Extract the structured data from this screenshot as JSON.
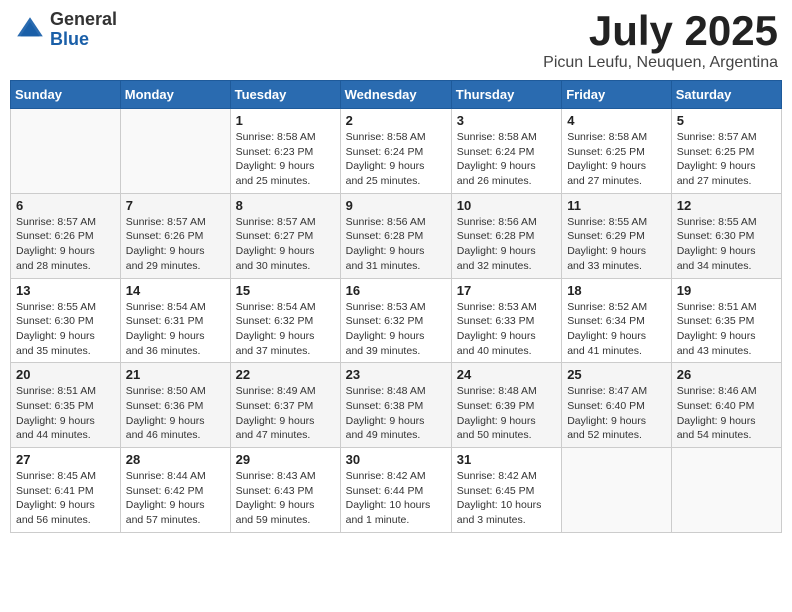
{
  "header": {
    "logo_general": "General",
    "logo_blue": "Blue",
    "month_title": "July 2025",
    "subtitle": "Picun Leufu, Neuquen, Argentina"
  },
  "weekdays": [
    "Sunday",
    "Monday",
    "Tuesday",
    "Wednesday",
    "Thursday",
    "Friday",
    "Saturday"
  ],
  "weeks": [
    [
      {
        "day": "",
        "content": ""
      },
      {
        "day": "",
        "content": ""
      },
      {
        "day": "1",
        "content": "Sunrise: 8:58 AM\nSunset: 6:23 PM\nDaylight: 9 hours\nand 25 minutes."
      },
      {
        "day": "2",
        "content": "Sunrise: 8:58 AM\nSunset: 6:24 PM\nDaylight: 9 hours\nand 25 minutes."
      },
      {
        "day": "3",
        "content": "Sunrise: 8:58 AM\nSunset: 6:24 PM\nDaylight: 9 hours\nand 26 minutes."
      },
      {
        "day": "4",
        "content": "Sunrise: 8:58 AM\nSunset: 6:25 PM\nDaylight: 9 hours\nand 27 minutes."
      },
      {
        "day": "5",
        "content": "Sunrise: 8:57 AM\nSunset: 6:25 PM\nDaylight: 9 hours\nand 27 minutes."
      }
    ],
    [
      {
        "day": "6",
        "content": "Sunrise: 8:57 AM\nSunset: 6:26 PM\nDaylight: 9 hours\nand 28 minutes."
      },
      {
        "day": "7",
        "content": "Sunrise: 8:57 AM\nSunset: 6:26 PM\nDaylight: 9 hours\nand 29 minutes."
      },
      {
        "day": "8",
        "content": "Sunrise: 8:57 AM\nSunset: 6:27 PM\nDaylight: 9 hours\nand 30 minutes."
      },
      {
        "day": "9",
        "content": "Sunrise: 8:56 AM\nSunset: 6:28 PM\nDaylight: 9 hours\nand 31 minutes."
      },
      {
        "day": "10",
        "content": "Sunrise: 8:56 AM\nSunset: 6:28 PM\nDaylight: 9 hours\nand 32 minutes."
      },
      {
        "day": "11",
        "content": "Sunrise: 8:55 AM\nSunset: 6:29 PM\nDaylight: 9 hours\nand 33 minutes."
      },
      {
        "day": "12",
        "content": "Sunrise: 8:55 AM\nSunset: 6:30 PM\nDaylight: 9 hours\nand 34 minutes."
      }
    ],
    [
      {
        "day": "13",
        "content": "Sunrise: 8:55 AM\nSunset: 6:30 PM\nDaylight: 9 hours\nand 35 minutes."
      },
      {
        "day": "14",
        "content": "Sunrise: 8:54 AM\nSunset: 6:31 PM\nDaylight: 9 hours\nand 36 minutes."
      },
      {
        "day": "15",
        "content": "Sunrise: 8:54 AM\nSunset: 6:32 PM\nDaylight: 9 hours\nand 37 minutes."
      },
      {
        "day": "16",
        "content": "Sunrise: 8:53 AM\nSunset: 6:32 PM\nDaylight: 9 hours\nand 39 minutes."
      },
      {
        "day": "17",
        "content": "Sunrise: 8:53 AM\nSunset: 6:33 PM\nDaylight: 9 hours\nand 40 minutes."
      },
      {
        "day": "18",
        "content": "Sunrise: 8:52 AM\nSunset: 6:34 PM\nDaylight: 9 hours\nand 41 minutes."
      },
      {
        "day": "19",
        "content": "Sunrise: 8:51 AM\nSunset: 6:35 PM\nDaylight: 9 hours\nand 43 minutes."
      }
    ],
    [
      {
        "day": "20",
        "content": "Sunrise: 8:51 AM\nSunset: 6:35 PM\nDaylight: 9 hours\nand 44 minutes."
      },
      {
        "day": "21",
        "content": "Sunrise: 8:50 AM\nSunset: 6:36 PM\nDaylight: 9 hours\nand 46 minutes."
      },
      {
        "day": "22",
        "content": "Sunrise: 8:49 AM\nSunset: 6:37 PM\nDaylight: 9 hours\nand 47 minutes."
      },
      {
        "day": "23",
        "content": "Sunrise: 8:48 AM\nSunset: 6:38 PM\nDaylight: 9 hours\nand 49 minutes."
      },
      {
        "day": "24",
        "content": "Sunrise: 8:48 AM\nSunset: 6:39 PM\nDaylight: 9 hours\nand 50 minutes."
      },
      {
        "day": "25",
        "content": "Sunrise: 8:47 AM\nSunset: 6:40 PM\nDaylight: 9 hours\nand 52 minutes."
      },
      {
        "day": "26",
        "content": "Sunrise: 8:46 AM\nSunset: 6:40 PM\nDaylight: 9 hours\nand 54 minutes."
      }
    ],
    [
      {
        "day": "27",
        "content": "Sunrise: 8:45 AM\nSunset: 6:41 PM\nDaylight: 9 hours\nand 56 minutes."
      },
      {
        "day": "28",
        "content": "Sunrise: 8:44 AM\nSunset: 6:42 PM\nDaylight: 9 hours\nand 57 minutes."
      },
      {
        "day": "29",
        "content": "Sunrise: 8:43 AM\nSunset: 6:43 PM\nDaylight: 9 hours\nand 59 minutes."
      },
      {
        "day": "30",
        "content": "Sunrise: 8:42 AM\nSunset: 6:44 PM\nDaylight: 10 hours\nand 1 minute."
      },
      {
        "day": "31",
        "content": "Sunrise: 8:42 AM\nSunset: 6:45 PM\nDaylight: 10 hours\nand 3 minutes."
      },
      {
        "day": "",
        "content": ""
      },
      {
        "day": "",
        "content": ""
      }
    ]
  ]
}
